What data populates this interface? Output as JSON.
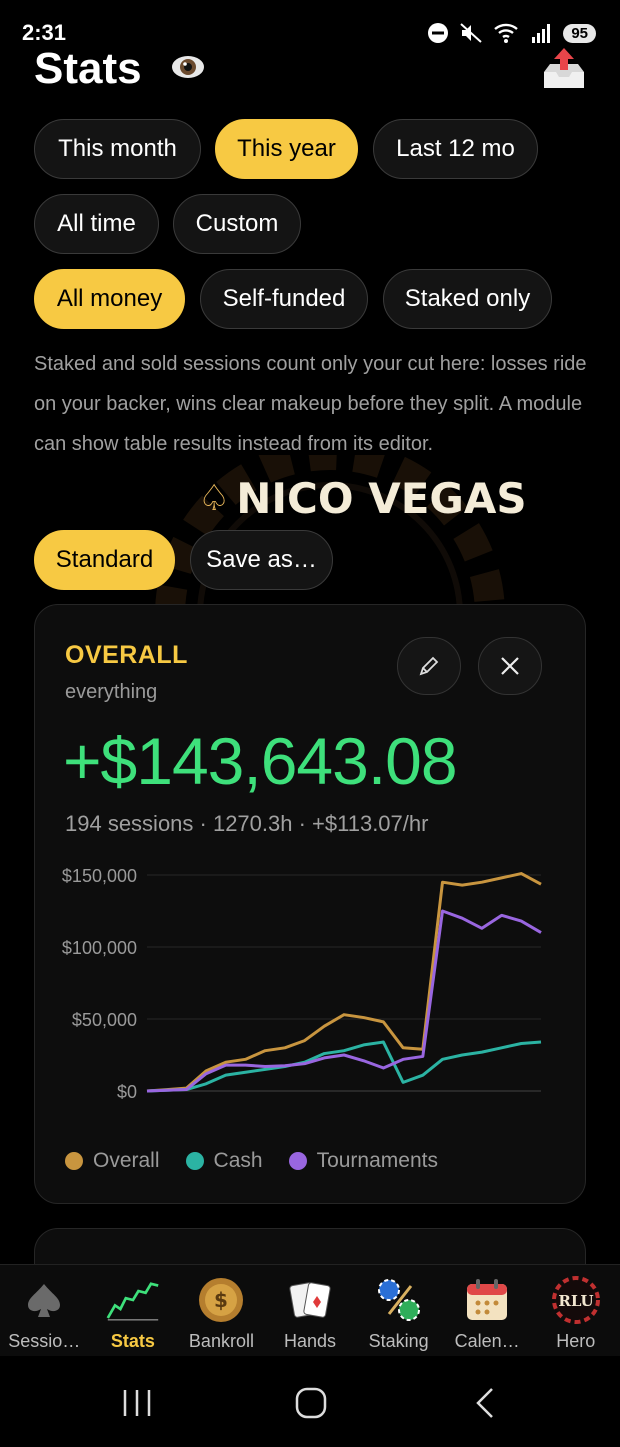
{
  "status": {
    "time": "2:31",
    "battery": "95"
  },
  "header": {
    "title": "Stats"
  },
  "period_filters": [
    {
      "label": "This month",
      "active": false
    },
    {
      "label": "This year",
      "active": true
    },
    {
      "label": "Last 12 mo",
      "active": false
    },
    {
      "label": "All time",
      "active": false
    },
    {
      "label": "Custom",
      "active": false
    }
  ],
  "money_filters": [
    {
      "label": "All money",
      "active": true
    },
    {
      "label": "Self-funded",
      "active": false
    },
    {
      "label": "Staked only",
      "active": false
    }
  ],
  "note": "Staked and sold sessions count only your cut here: losses ride on your backer, wins clear makeup before they split. A module can show table results instead from its editor.",
  "brand": {
    "name": "NICO VEGAS"
  },
  "layout_presets": [
    {
      "label": "Standard",
      "active": true
    },
    {
      "label": "Save as…",
      "active": false
    }
  ],
  "card": {
    "title": "OVERALL",
    "subtitle": "everything",
    "value": "+$143,643.08",
    "summary": "194 sessions · 1270.3h · +$113.07/hr"
  },
  "chart_data": {
    "type": "line",
    "y_ticks": [
      "$0",
      "$50,000",
      "$100,000",
      "$150,000"
    ],
    "ylim": [
      0,
      150000
    ],
    "grid": true,
    "legend_position": "bottom",
    "x": [
      0,
      5,
      10,
      15,
      20,
      25,
      30,
      35,
      40,
      45,
      50,
      55,
      60,
      65,
      70,
      75,
      80,
      85,
      90,
      95,
      100
    ],
    "series": [
      {
        "name": "Overall",
        "color": "#c8953f",
        "values": [
          0,
          1000,
          2000,
          14000,
          20000,
          22000,
          28000,
          30000,
          35000,
          45000,
          53000,
          51000,
          48000,
          30000,
          29000,
          145000,
          143000,
          145000,
          148000,
          151000,
          143600
        ]
      },
      {
        "name": "Cash",
        "color": "#2bb3a3",
        "values": [
          0,
          500,
          1000,
          5000,
          11000,
          13000,
          15000,
          17000,
          20000,
          26000,
          28000,
          32000,
          34000,
          6000,
          11000,
          22000,
          25000,
          27000,
          30000,
          33000,
          34000
        ]
      },
      {
        "name": "Tournaments",
        "color": "#9966e0",
        "values": [
          0,
          500,
          1000,
          12000,
          18000,
          18000,
          17000,
          17500,
          19000,
          23000,
          25000,
          21000,
          16000,
          22000,
          24000,
          125000,
          120000,
          113000,
          122000,
          118000,
          110000
        ]
      }
    ]
  },
  "nav": [
    {
      "label": "Sessio…",
      "icon": "spade-icon",
      "active": false
    },
    {
      "label": "Stats",
      "icon": "chart-icon",
      "active": true
    },
    {
      "label": "Bankroll",
      "icon": "coin-icon",
      "active": false
    },
    {
      "label": "Hands",
      "icon": "cards-icon",
      "active": false
    },
    {
      "label": "Staking",
      "icon": "chips-icon",
      "active": false
    },
    {
      "label": "Calen…",
      "icon": "calendar-icon",
      "active": false
    },
    {
      "label": "Hero",
      "icon": "rlu-icon",
      "active": false
    }
  ]
}
